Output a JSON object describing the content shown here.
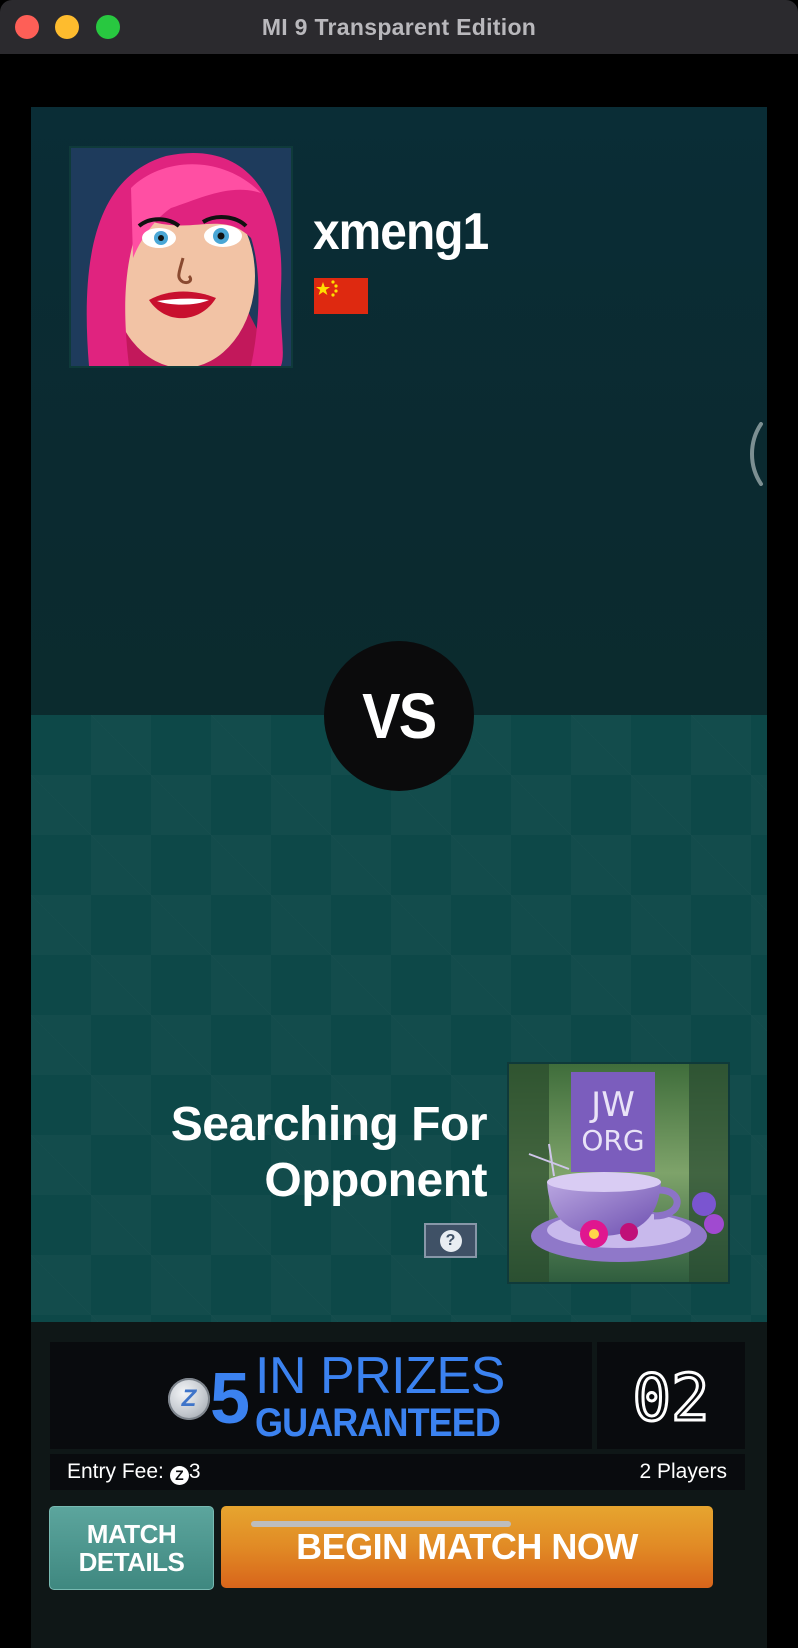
{
  "window": {
    "title": "MI 9 Transparent Edition"
  },
  "player1": {
    "name": "xmeng1",
    "avatar_icon": "cartoon-woman-avatar",
    "flag": "china-flag"
  },
  "versus": {
    "label": "VS"
  },
  "player2": {
    "status_line1": "Searching For",
    "status_line2": "Opponent",
    "help_label": "?",
    "avatar_icon": "teacup-avatar",
    "avatar_text_1": "JW",
    "avatar_text_2": "ORG"
  },
  "prize": {
    "coin_icon": "z-coin-icon",
    "coin_label": "Z",
    "amount": "5",
    "line1": "IN PRIZES",
    "line2": "GUARANTEED",
    "counter": "02"
  },
  "entry": {
    "fee_label": "Entry Fee:",
    "fee_coin": "Z",
    "fee_amount": "3",
    "players": "2 Players"
  },
  "buttons": {
    "match_details_1": "MATCH",
    "match_details_2": "DETAILS",
    "begin": "BEGIN MATCH NOW"
  },
  "colors": {
    "accent_blue": "#3b82f0",
    "begin_orange": "#e18a25",
    "details_teal": "#4f968e"
  }
}
